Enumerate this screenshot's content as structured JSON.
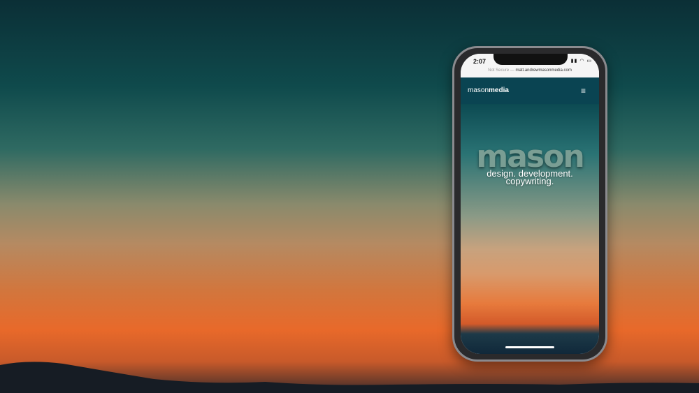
{
  "status": {
    "time": "2:07"
  },
  "browser": {
    "not_secure": "Not Secure —",
    "url": "matt.andrewmasonmedia.com"
  },
  "nav": {
    "logo_light": "mason",
    "logo_bold": "media"
  },
  "hero": {
    "title": "mason",
    "tagline_1": "design. development.",
    "tagline_2": "copywriting."
  }
}
